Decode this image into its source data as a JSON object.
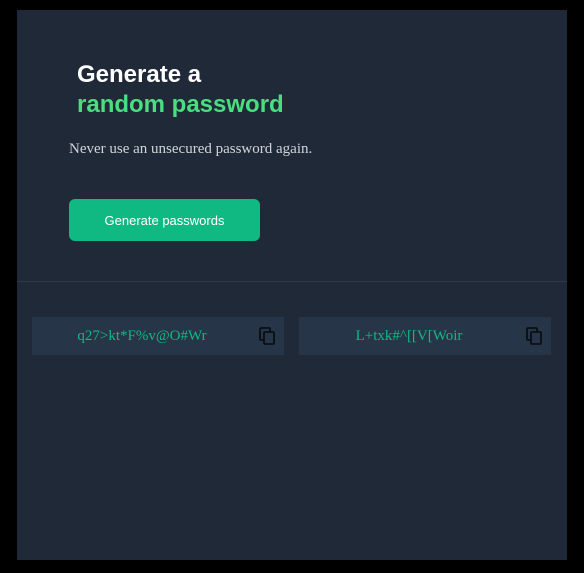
{
  "header": {
    "title_line1": "Generate a",
    "title_line2": "random password",
    "subtitle": "Never use an unsecured password again."
  },
  "actions": {
    "generate_label": "Generate passwords"
  },
  "passwords": [
    {
      "value": "q27>kt*F%v@O#Wr",
      "icon": "copy-icon"
    },
    {
      "value": "L+txk#^[[V[Woir",
      "icon": "copy-icon"
    }
  ],
  "colors": {
    "background": "#1f2937",
    "accent": "#10b981",
    "title_highlight": "#4ade80",
    "password_box": "#273549"
  }
}
